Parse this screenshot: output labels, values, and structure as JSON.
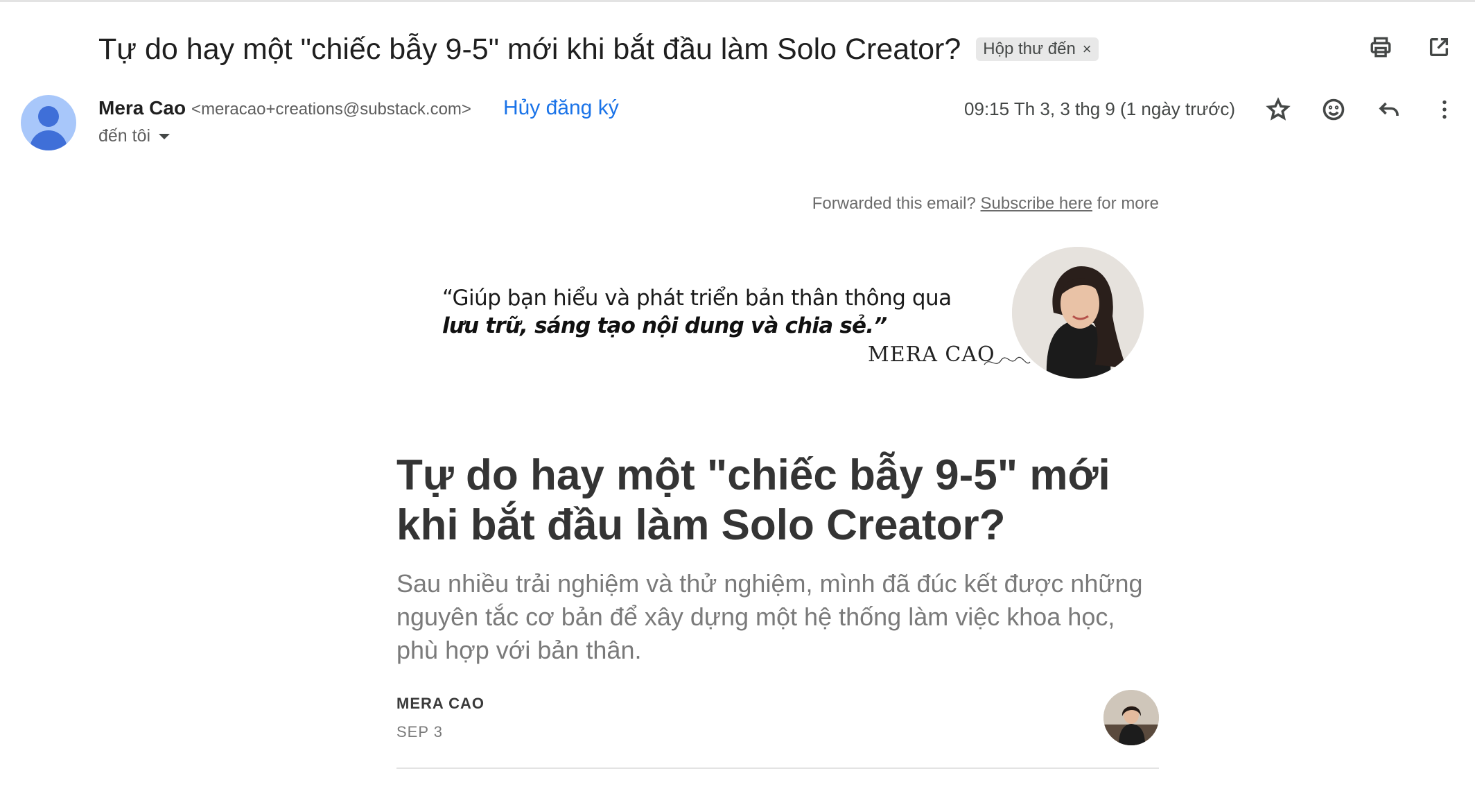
{
  "email": {
    "subject": "Tự do hay một \"chiếc bẫy 9-5\" mới khi bắt đầu làm Solo Creator?",
    "label": "Hộp thư đến",
    "label_remove": "×",
    "sender_name": "Mera Cao",
    "sender_email": "<meracao+creations@substack.com>",
    "unsubscribe": "Hủy đăng ký",
    "recipient": "đến tôi",
    "timestamp": "09:15 Th 3, 3 thg 9 (1 ngày trước)"
  },
  "icons": {
    "print": "print-icon",
    "open_new_window": "open-in-new-window-icon",
    "star": "star-icon",
    "emoji": "emoji-icon",
    "reply": "reply-icon",
    "more": "more-vert-icon"
  },
  "newsletter": {
    "forwarded_text": "Forwarded this email?",
    "subscribe_link": "Subscribe here",
    "forwarded_suffix": "for more",
    "banner_quote_line1": "“Giúp bạn hiểu và phát triển bản thân thông qua",
    "banner_quote_line2": "lưu trữ, sáng tạo nội dung và chia sẻ.”",
    "banner_signature": "MERA CAO",
    "article_title": "Tự do hay một \"chiếc bẫy 9-5\" mới khi bắt đầu làm Solo Creator?",
    "article_subtitle": "Sau nhiều trải nghiệm và thử nghiệm, mình đã đúc kết được những nguyên tắc cơ bản để xây dựng một hệ thống làm việc khoa học, phù hợp với bản thân.",
    "author": "MERA CAO",
    "date": "SEP 3"
  },
  "colors": {
    "link_blue": "#1a73e8",
    "avatar_bg": "#a8c7fa",
    "avatar_fg": "#3f6fd8",
    "chip_bg": "#e8e8e8"
  }
}
